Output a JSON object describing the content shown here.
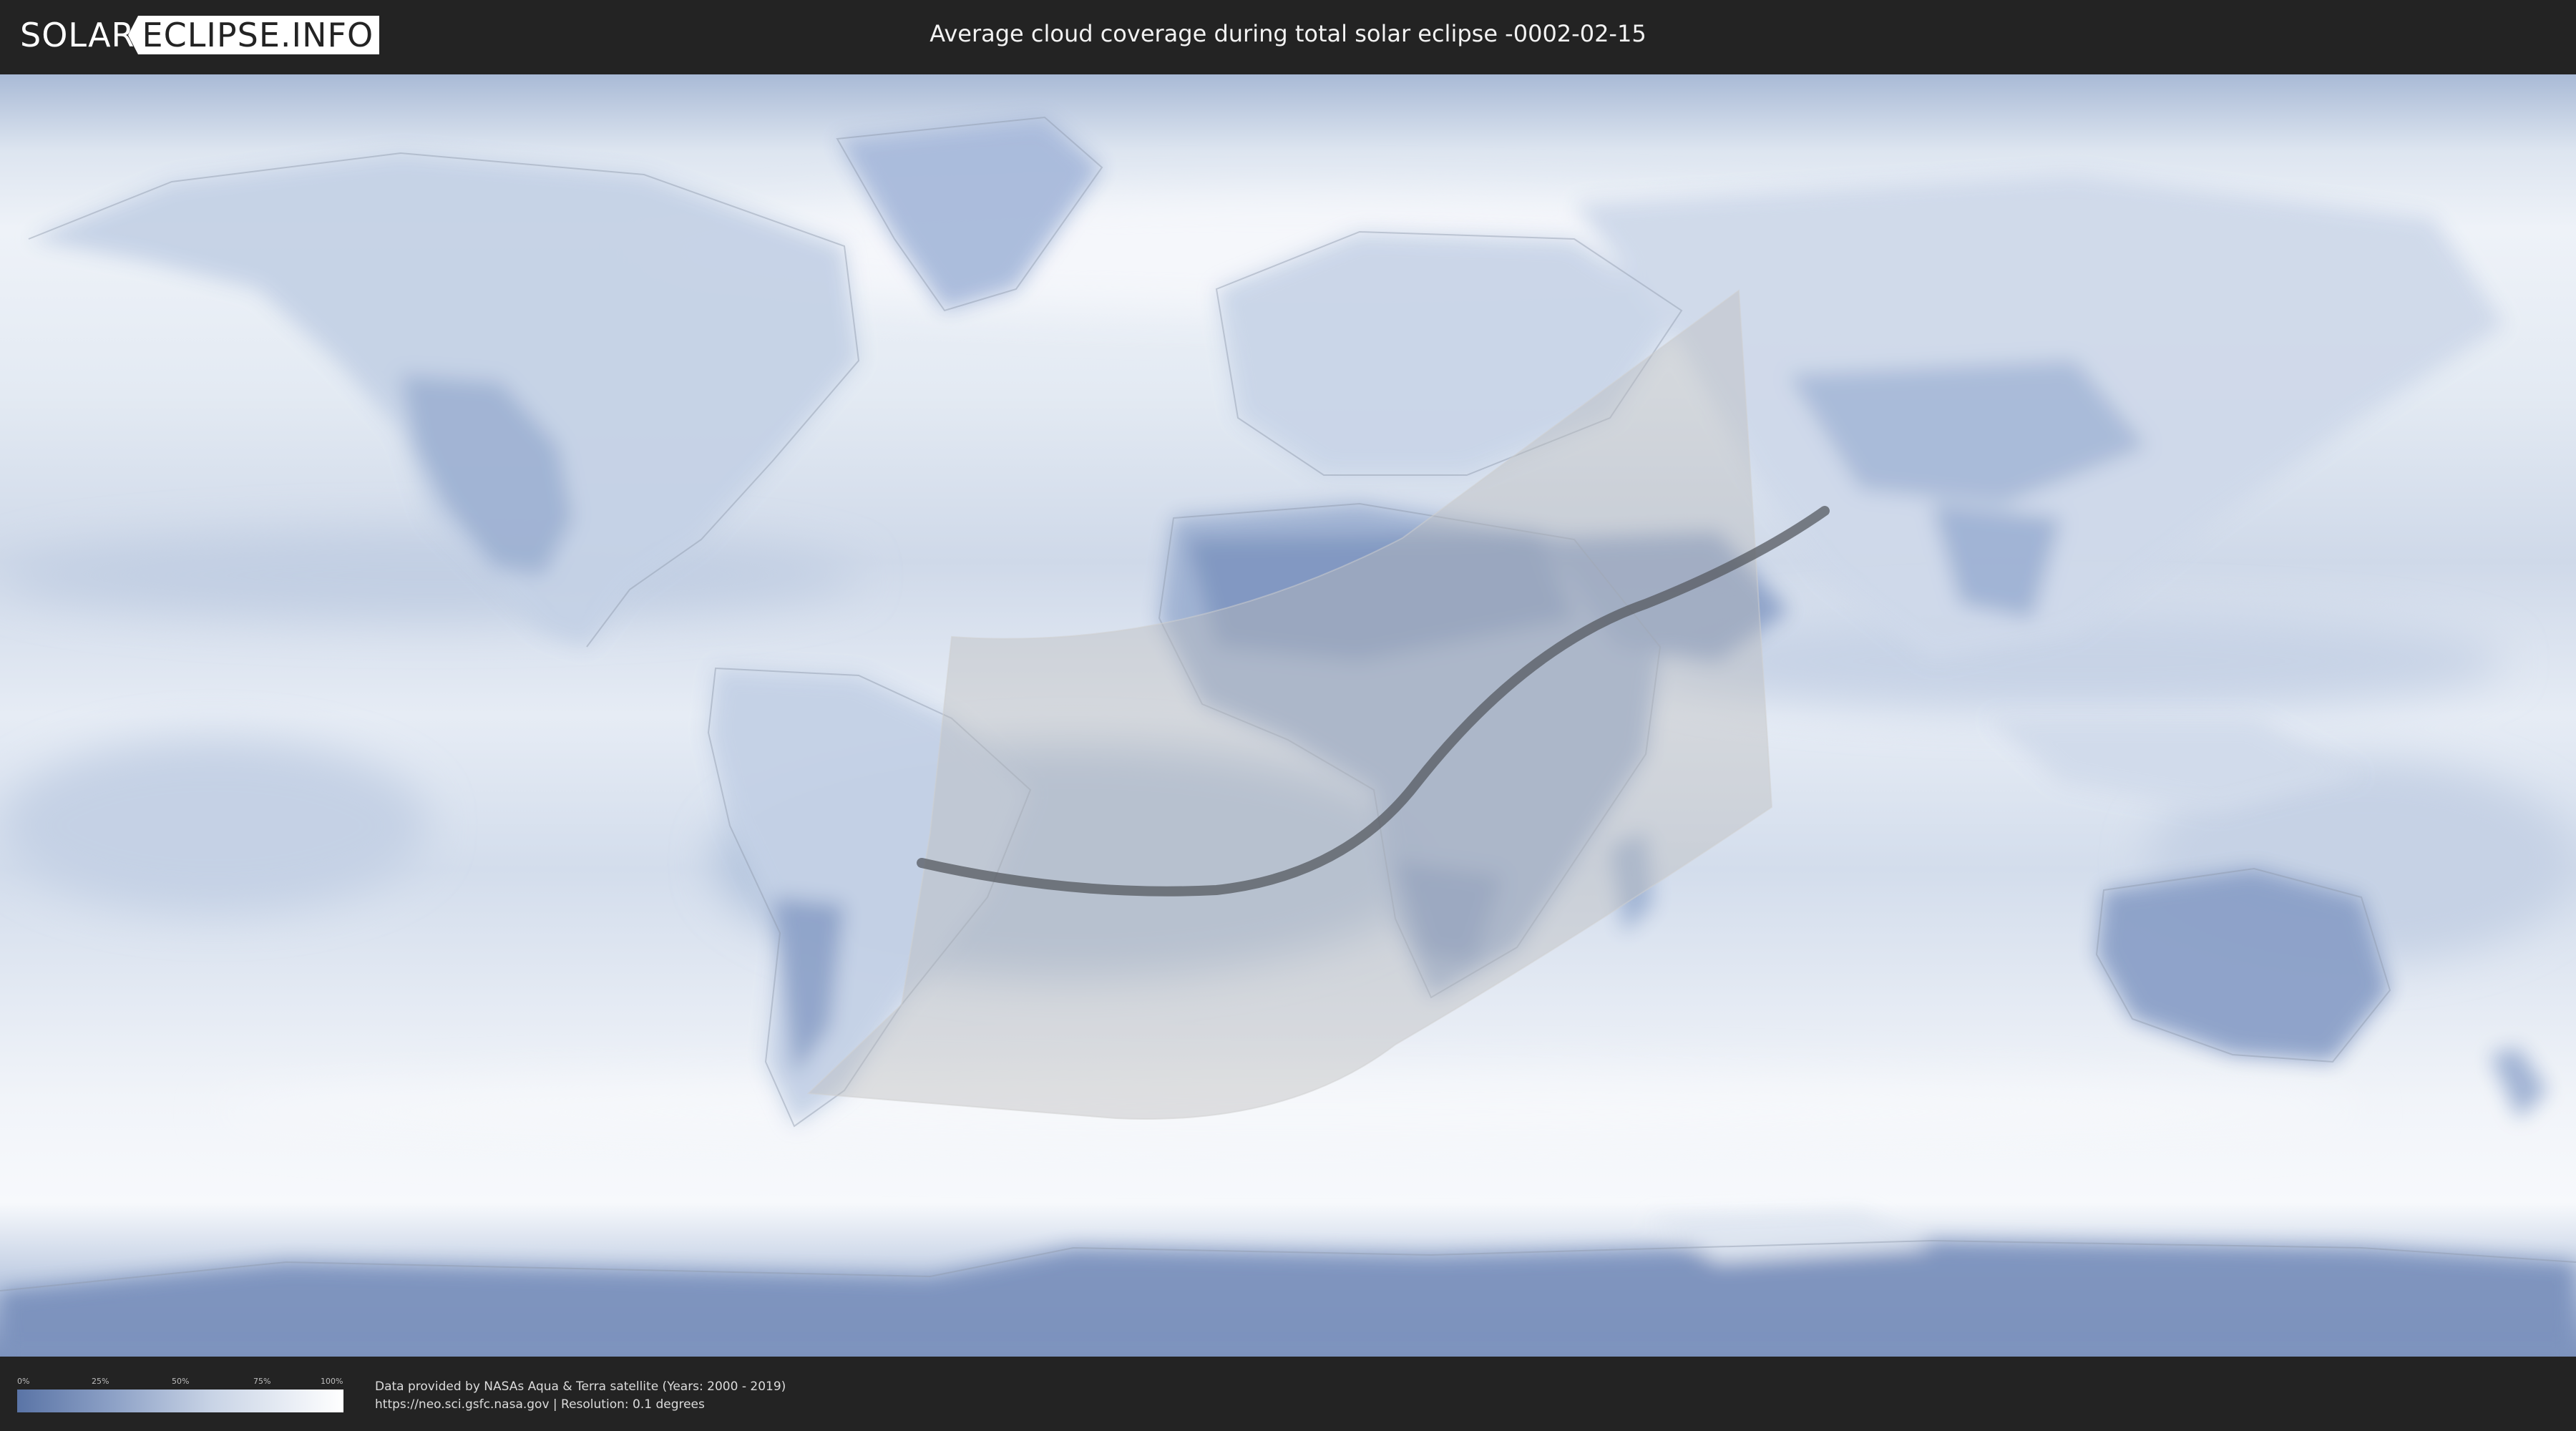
{
  "header": {
    "logo_left": "SOLAR",
    "logo_right": "ECLIPSE.INFO",
    "title": "Average cloud coverage during total solar eclipse -0002-02-15"
  },
  "legend": {
    "ticks": [
      "0%",
      "25%",
      "50%",
      "75%",
      "100%"
    ],
    "gradient_colors": [
      "#5a74a6",
      "#8ea2c7",
      "#c9d4e6",
      "#ffffff"
    ]
  },
  "footer": {
    "credit_line1": "Data provided by NASAs Aqua & Terra satellite (Years: 2000 - 2019)",
    "credit_line2": "https://neo.sci.gsfc.nasa.gov | Resolution: 0.1 degrees"
  },
  "map": {
    "projection": "equirectangular world map",
    "colors": {
      "clear_sky": "#6f88b6",
      "cloudy": "#f4f7fb",
      "penumbra_overlay": "#bdbdbd",
      "central_line": "#555a60"
    },
    "eclipse_path": {
      "description_visible": false
    }
  }
}
